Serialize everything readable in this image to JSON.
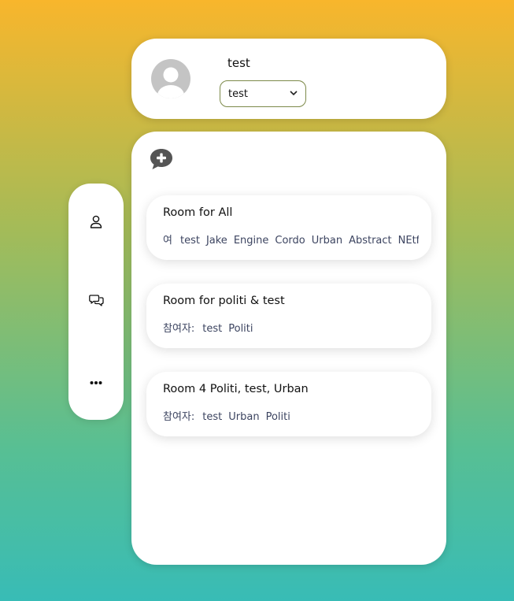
{
  "profile": {
    "username": "test",
    "select_value": "test"
  },
  "sidebar": {
    "items": [
      {
        "icon": "user-icon"
      },
      {
        "icon": "chat-icon"
      },
      {
        "icon": "more-icon"
      }
    ]
  },
  "rooms": {
    "new_chat_icon": "chat-add-icon",
    "list": [
      {
        "title": "Room for All",
        "members_label": "여",
        "members": [
          "test",
          "Jake",
          "Engine",
          "Cordo",
          "Urban",
          "Abstract",
          "NEtfl"
        ]
      },
      {
        "title": "Room for politi & test",
        "members_label": "참여자:",
        "members": [
          "test",
          "Politi"
        ]
      },
      {
        "title": "Room 4 Politi, test, Urban",
        "members_label": "참여자:",
        "members": [
          "test",
          "Urban",
          "Politi"
        ]
      }
    ]
  },
  "colors": {
    "gradient_top": "#f8b62c",
    "gradient_mid": "#a4bb58",
    "gradient_bottom": "#38bcb6",
    "member_text": "#3c4460"
  }
}
